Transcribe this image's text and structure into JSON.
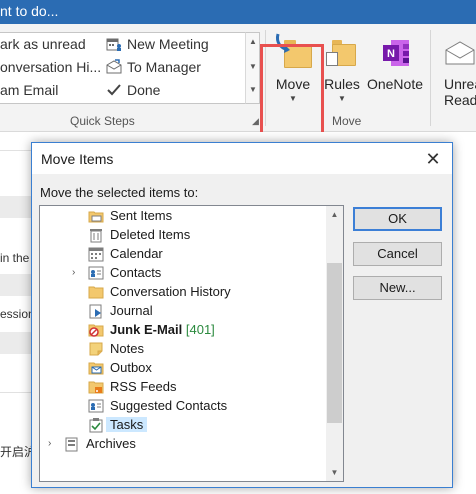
{
  "titlebar": {
    "text": "nt to do..."
  },
  "quick_steps": {
    "items": [
      {
        "label": "ark as unread",
        "icon": "flag-envelope-icon"
      },
      {
        "label": "onversation Hi...",
        "icon": "folder-icon"
      },
      {
        "label": "am Email",
        "icon": "envelope-icon"
      },
      {
        "label": "New Meeting",
        "icon": "calendar-people-icon"
      },
      {
        "label": "To Manager",
        "icon": "forward-envelope-icon"
      },
      {
        "label": "Done",
        "icon": "checkmark-icon"
      }
    ],
    "group_label": "Quick Steps"
  },
  "move_group": {
    "buttons": [
      {
        "label": "Move",
        "icon": "move-folder-icon"
      },
      {
        "label": "Rules",
        "icon": "rules-folder-icon"
      },
      {
        "label": "OneNote",
        "icon": "onenote-icon"
      },
      {
        "label": "Unread",
        "label2": "Read",
        "icon": "envelope-icon"
      }
    ],
    "group_label": "Move"
  },
  "background": {
    "snippets": [
      "in the",
      "ession",
      "开启沪"
    ]
  },
  "dialog": {
    "title": "Move Items",
    "prompt": "Move the selected items to:",
    "folders": [
      {
        "label": "Sent Items",
        "icon": "sent-items-icon"
      },
      {
        "label": "Deleted Items",
        "icon": "trash-icon"
      },
      {
        "label": "Calendar",
        "icon": "calendar-icon"
      },
      {
        "label": "Contacts",
        "icon": "contacts-icon",
        "expandable": true
      },
      {
        "label": "Conversation History",
        "icon": "folder-icon"
      },
      {
        "label": "Journal",
        "icon": "journal-icon"
      },
      {
        "label": "Junk E-Mail",
        "count": "[401]",
        "icon": "junk-mail-icon",
        "bold": true
      },
      {
        "label": "Notes",
        "icon": "notes-icon"
      },
      {
        "label": "Outbox",
        "icon": "outbox-icon"
      },
      {
        "label": "RSS Feeds",
        "icon": "rss-icon"
      },
      {
        "label": "Suggested Contacts",
        "icon": "contacts-icon"
      },
      {
        "label": "Tasks",
        "icon": "tasks-icon",
        "selected": true
      },
      {
        "label": "Archives",
        "icon": "archive-icon",
        "expandable": true
      }
    ],
    "buttons": {
      "ok": "OK",
      "cancel": "Cancel",
      "new": "New..."
    }
  },
  "colors": {
    "title_bar": "#2b6cb3",
    "highlight_box": "#e8504f",
    "selected_row": "#cce8ff",
    "unread_count": "#2b8a3e"
  }
}
